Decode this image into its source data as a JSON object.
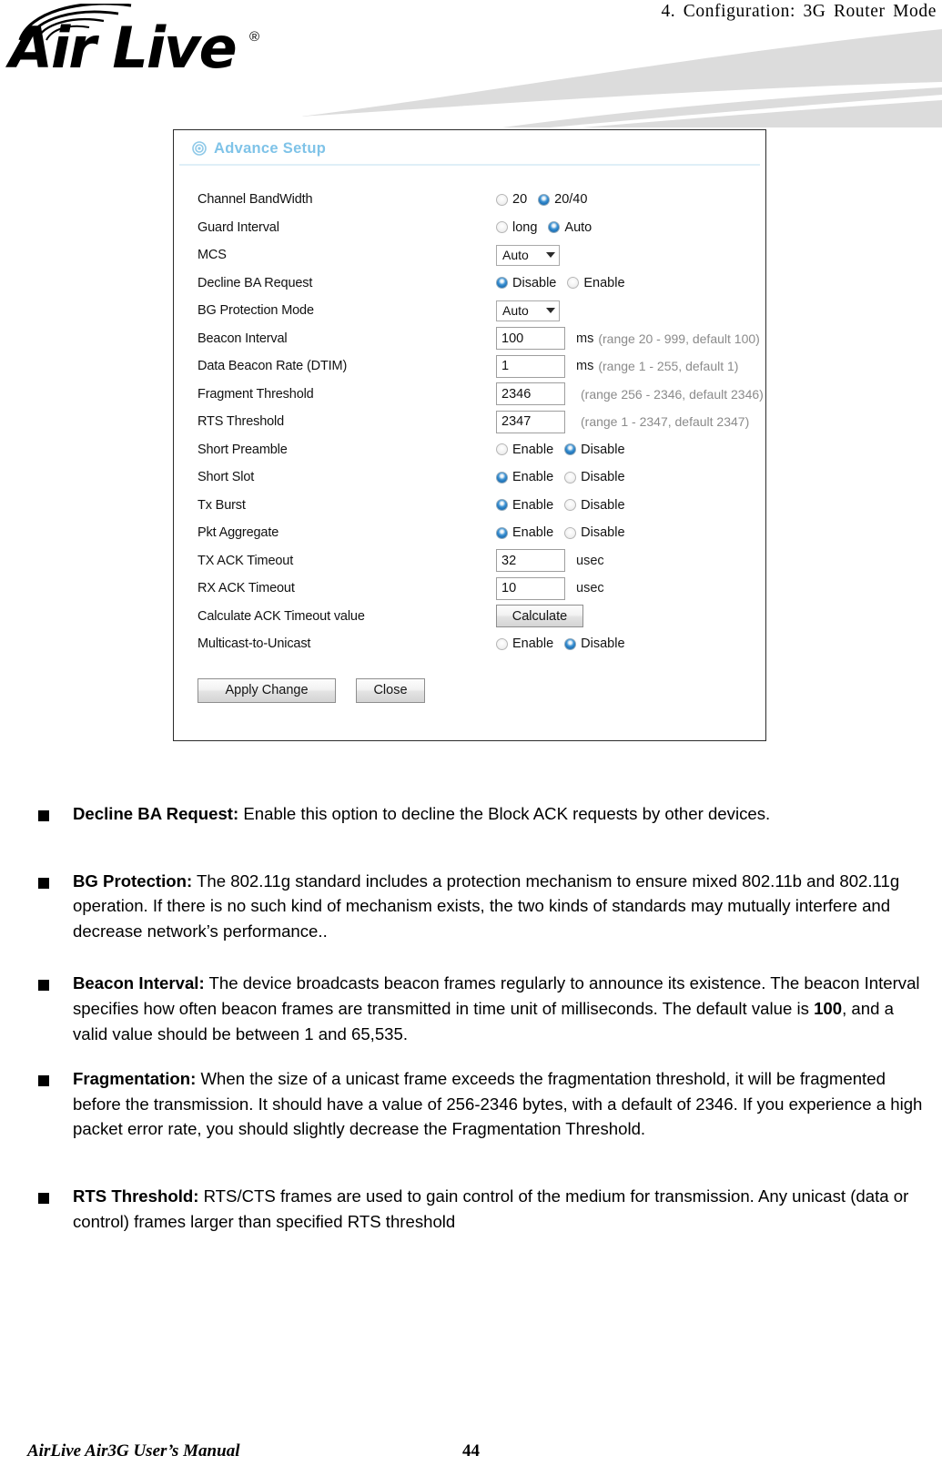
{
  "page_header": {
    "chapter_title": "4.  Configuration:  3G  Router  Mode",
    "logo_text": "Air Live",
    "logo_trademark": "®"
  },
  "panel": {
    "title": "Advance Setup",
    "title_icon": "target-icon",
    "rows": [
      {
        "label": "Channel BandWidth",
        "type": "radio",
        "options": [
          {
            "label": "20",
            "selected": false
          },
          {
            "label": "20/40",
            "selected": true
          }
        ]
      },
      {
        "label": "Guard Interval",
        "type": "radio",
        "options": [
          {
            "label": "long",
            "selected": false
          },
          {
            "label": "Auto",
            "selected": true
          }
        ]
      },
      {
        "label": "MCS",
        "type": "select",
        "value": "Auto"
      },
      {
        "label": "Decline BA Request",
        "type": "radio",
        "options": [
          {
            "label": "Disable",
            "selected": true
          },
          {
            "label": "Enable",
            "selected": false
          }
        ]
      },
      {
        "label": "BG Protection Mode",
        "type": "select",
        "value": "Auto"
      },
      {
        "label": "Beacon Interval",
        "type": "text",
        "value": "100",
        "unit": "ms",
        "hint": "(range 20 - 999, default 100)"
      },
      {
        "label": "Data Beacon Rate (DTIM)",
        "type": "text",
        "value": "1",
        "unit": "ms",
        "hint": "(range 1 - 255, default 1)"
      },
      {
        "label": "Fragment Threshold",
        "type": "text",
        "value": "2346",
        "unit": "",
        "hint": "(range 256 - 2346, default 2346)"
      },
      {
        "label": "RTS Threshold",
        "type": "text",
        "value": "2347",
        "unit": "",
        "hint": "(range 1 - 2347, default 2347)"
      },
      {
        "label": "Short Preamble",
        "type": "radio",
        "options": [
          {
            "label": "Enable",
            "selected": false
          },
          {
            "label": "Disable",
            "selected": true
          }
        ]
      },
      {
        "label": "Short Slot",
        "type": "radio",
        "options": [
          {
            "label": "Enable",
            "selected": true
          },
          {
            "label": "Disable",
            "selected": false
          }
        ]
      },
      {
        "label": "Tx Burst",
        "type": "radio",
        "options": [
          {
            "label": "Enable",
            "selected": true
          },
          {
            "label": "Disable",
            "selected": false
          }
        ]
      },
      {
        "label": "Pkt Aggregate",
        "type": "radio",
        "options": [
          {
            "label": "Enable",
            "selected": true
          },
          {
            "label": "Disable",
            "selected": false
          }
        ]
      },
      {
        "label": "TX ACK Timeout",
        "type": "text",
        "value": "32",
        "unit": "usec",
        "hint": ""
      },
      {
        "label": "RX ACK Timeout",
        "type": "text",
        "value": "10",
        "unit": "usec",
        "hint": ""
      },
      {
        "label": "Calculate ACK Timeout value",
        "type": "button",
        "button_label": "Calculate"
      },
      {
        "label": "Multicast-to-Unicast",
        "type": "radio",
        "options": [
          {
            "label": "Enable",
            "selected": false
          },
          {
            "label": "Disable",
            "selected": true
          }
        ]
      }
    ],
    "apply_button": "Apply Change",
    "close_button": "Close"
  },
  "body": {
    "items": [
      {
        "term": "Decline BA Request:",
        "text": " Enable this option to decline the Block ACK requests by other devices."
      },
      {
        "term": "BG Protection:",
        "text": "   The 802.11g standard includes a protection mechanism to ensure mixed 802.11b and 802.11g operation. If there is no such kind of mechanism exists, the two kinds of standards may mutually interfere and decrease network’s performance.."
      },
      {
        "term": "Beacon Interval:",
        "text": " The device broadcasts beacon frames regularly to announce its existence. The beacon Interval specifies how often beacon frames are transmitted in time unit of milliseconds. The default value is ",
        "bold_value": "100",
        "text_after": ", and a valid value should be between 1 and 65,535."
      },
      {
        "term": "Fragmentation:",
        "text": " When the size of a unicast frame exceeds the fragmentation threshold, it will be fragmented before the transmission. It should have a value of 256-2346 bytes, with a default of 2346.    If you experience a high packet error rate, you should slightly decrease the Fragmentation Threshold."
      },
      {
        "term": "RTS Threshold:",
        "text": " RTS/CTS frames are used to gain control of the medium for transmission. Any unicast (data or control) frames larger than specified RTS threshold"
      }
    ]
  },
  "footer": {
    "manual_title": "AirLive Air3G User’s Manual",
    "page_number": "44"
  }
}
